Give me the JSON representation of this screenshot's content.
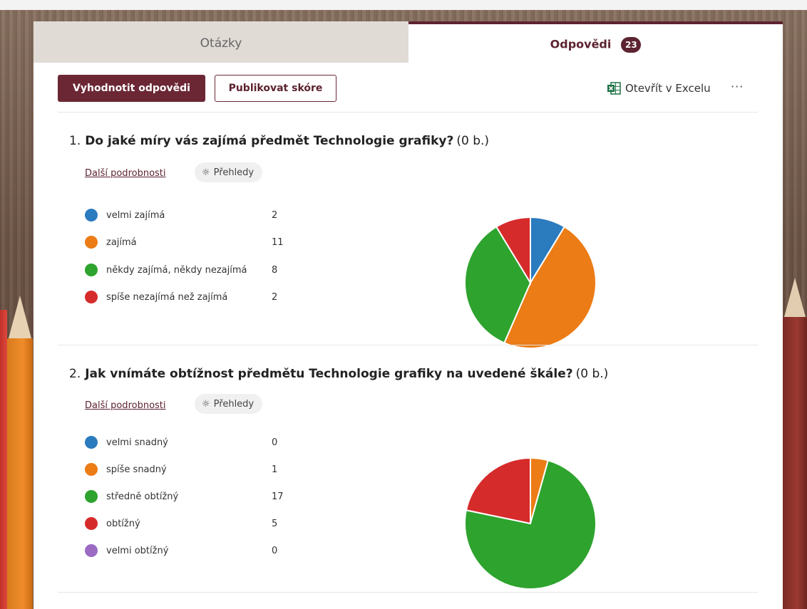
{
  "tabs": {
    "questions": "Otázky",
    "responses": "Odpovědi",
    "responses_count": "23"
  },
  "toolbar": {
    "evaluate_label": "Vyhodnotit odpovědi",
    "publish_label": "Publikovat skóre",
    "excel_label": "Otevřít v Excelu",
    "more_label": "···"
  },
  "questions": [
    {
      "number": "1.",
      "text": "Do jaké míry vás zajímá předmět Technologie grafiky?",
      "points": "(0 b.)",
      "details": "Další podrobnosti",
      "insights": "Přehledy",
      "options": [
        {
          "label": "velmi zajímá",
          "count": "2",
          "color": "#2b7bbf"
        },
        {
          "label": "zajímá",
          "count": "11",
          "color": "#ec7c15"
        },
        {
          "label": "někdy zajímá, někdy nezajímá",
          "count": "8",
          "color": "#2ea32e"
        },
        {
          "label": "spíše nezajímá než zajímá",
          "count": "2",
          "color": "#d62b2b"
        }
      ]
    },
    {
      "number": "2.",
      "text": "Jak vnímáte obtížnost předmětu Technologie grafiky na uvedené škále?",
      "points": "(0 b.)",
      "details": "Další podrobnosti",
      "insights": "Přehledy",
      "options": [
        {
          "label": "velmi snadný",
          "count": "0",
          "color": "#2b7bbf"
        },
        {
          "label": "spíše snadný",
          "count": "1",
          "color": "#ec7c15"
        },
        {
          "label": "středně obtížný",
          "count": "17",
          "color": "#2ea32e"
        },
        {
          "label": "obtížný",
          "count": "5",
          "color": "#d62b2b"
        },
        {
          "label": "velmi obtížný",
          "count": "0",
          "color": "#9b6bc4"
        }
      ]
    }
  ],
  "chart_data": [
    {
      "type": "pie",
      "categories": [
        "velmi zajímá",
        "zajímá",
        "někdy zajímá, někdy nezajímá",
        "spíše nezajímá než zajímá"
      ],
      "values": [
        2,
        11,
        8,
        2
      ],
      "colors": [
        "#2b7bbf",
        "#ec7c15",
        "#2ea32e",
        "#d62b2b"
      ]
    },
    {
      "type": "pie",
      "categories": [
        "velmi snadný",
        "spíše snadný",
        "středně obtížný",
        "obtížný",
        "velmi obtížný"
      ],
      "values": [
        0,
        1,
        17,
        5,
        0
      ],
      "colors": [
        "#2b7bbf",
        "#ec7c15",
        "#2ea32e",
        "#d62b2b",
        "#9b6bc4"
      ]
    }
  ]
}
